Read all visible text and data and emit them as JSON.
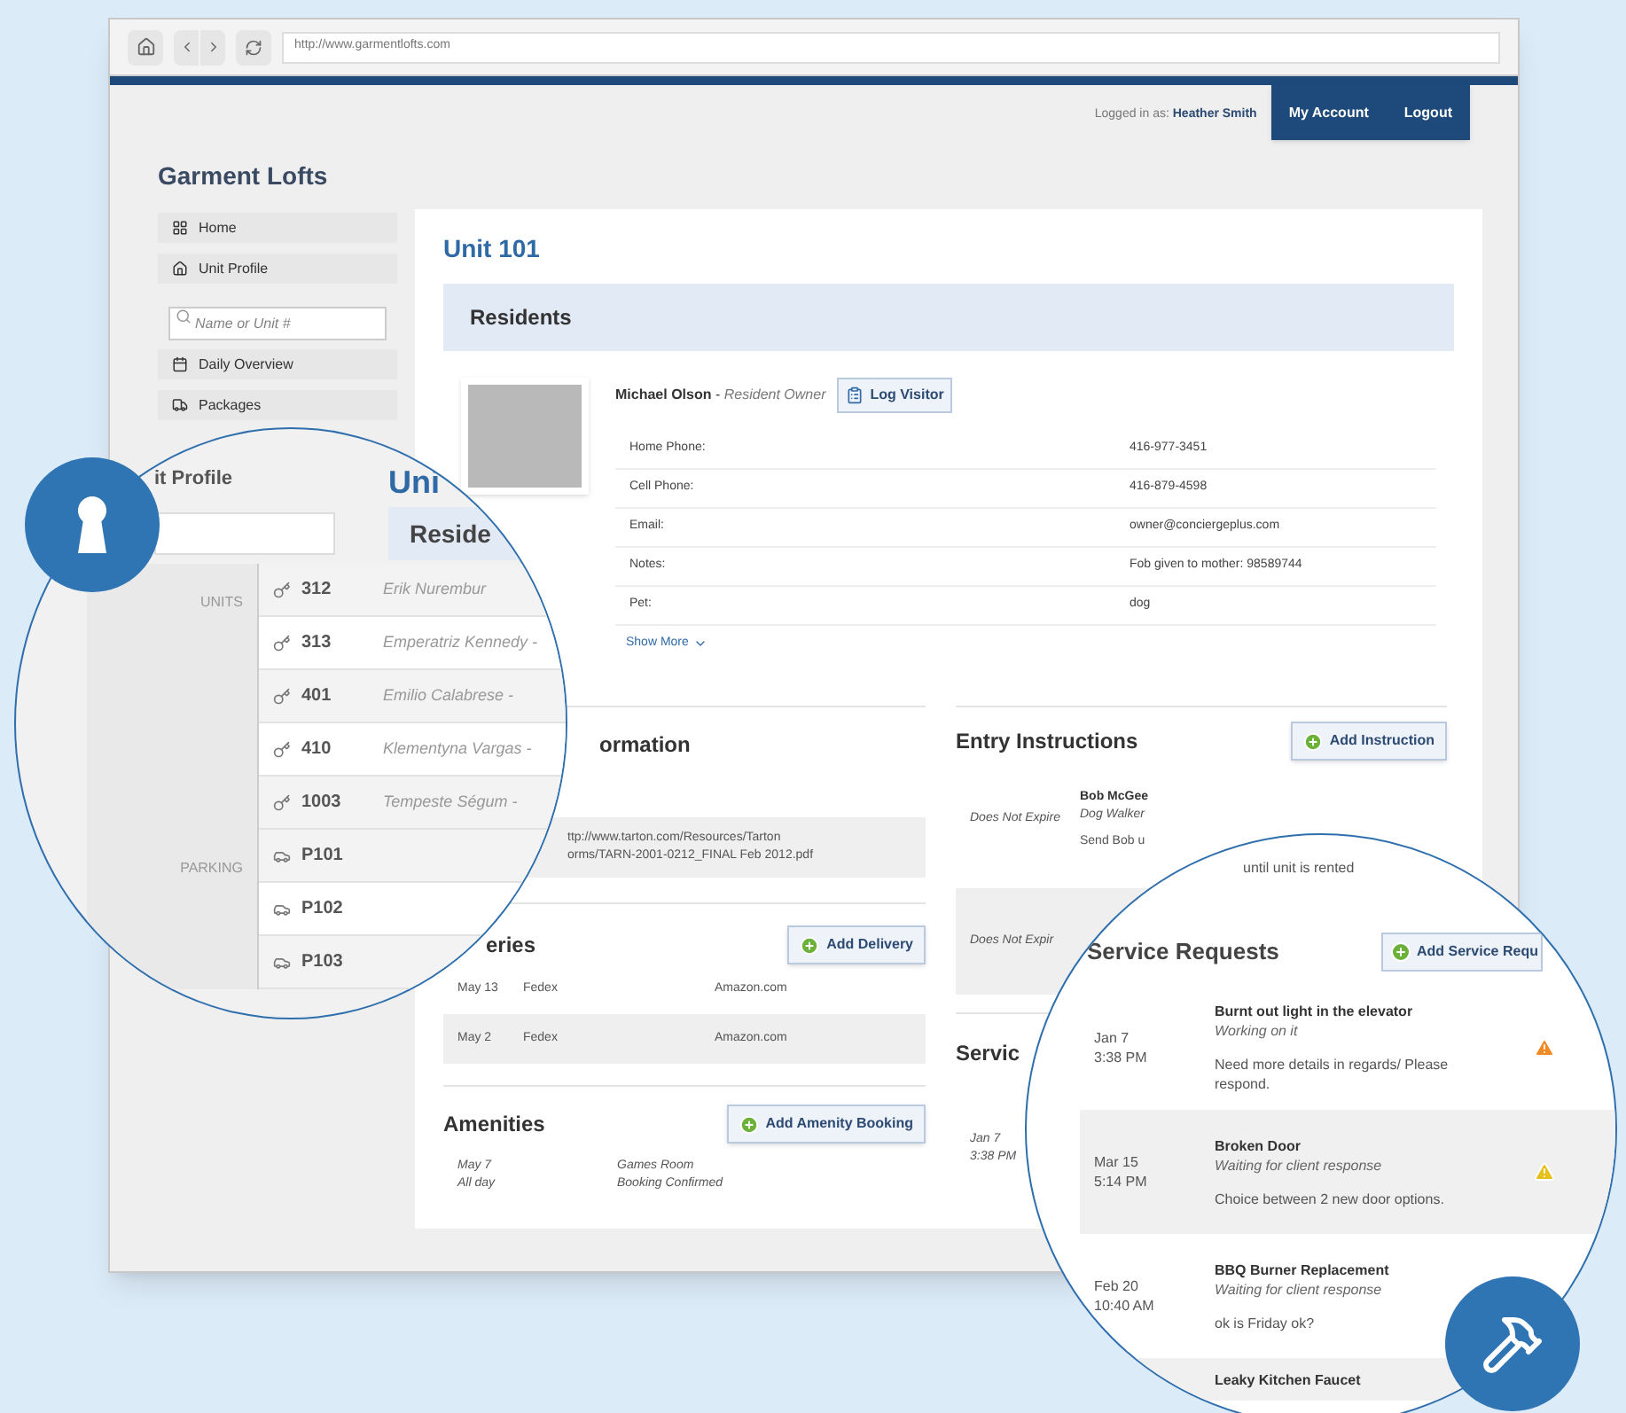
{
  "browser": {
    "url": "http://www.garmentlofts.com"
  },
  "header": {
    "logged_in_label": "Logged in as:",
    "user": "Heather Smith",
    "nav": [
      {
        "label": "My Account"
      },
      {
        "label": "Logout"
      }
    ]
  },
  "site_title": "Garment Lofts",
  "sidebar": {
    "items": [
      {
        "kind": "link",
        "label": "Home"
      },
      {
        "kind": "link",
        "label": "Unit Profile"
      },
      {
        "kind": "search",
        "placeholder": "Name or Unit #"
      },
      {
        "kind": "link",
        "label": "Daily Overview"
      },
      {
        "kind": "link",
        "label": "Packages"
      }
    ]
  },
  "unit": {
    "title": "Unit 101",
    "residents_heading": "Residents",
    "resident": {
      "name": "Michael Olson",
      "separator": "-",
      "role": "Resident Owner",
      "log_button": "Log Visitor",
      "show_more": "Show More",
      "details": [
        {
          "label": "Home Phone:",
          "value": "416-977-3451"
        },
        {
          "label": "Cell Phone:",
          "value": "416-879-4598"
        },
        {
          "label": "Email:",
          "value": "owner@conciergeplus.com"
        },
        {
          "label": "Notes:",
          "value": "Fob given to mother: 98589744"
        },
        {
          "label": "Pet:",
          "value": "dog"
        }
      ]
    }
  },
  "unit_information": {
    "heading": "ormation",
    "link_lines": [
      "ttp://www.tarton.com/Resources/Tarton",
      "orms/TARN-2001-0212_FINAL Feb 2012.pdf"
    ]
  },
  "deliveries": {
    "heading": "eries",
    "button": "Add Delivery",
    "rows": [
      {
        "date": "May 13",
        "carrier": "Fedex",
        "sender": "Amazon.com"
      },
      {
        "date": "May 2",
        "carrier": "Fedex",
        "sender": "Amazon.com"
      }
    ]
  },
  "amenities": {
    "heading": "Amenities",
    "button": "Add Amenity Booking",
    "rows": [
      {
        "date": "May 7",
        "time": "All day",
        "room": "Games Room",
        "status": "Booking Confirmed"
      }
    ]
  },
  "entry_instructions": {
    "heading": "Entry Instructions",
    "button": "Add Instruction",
    "rows": [
      {
        "expiry": "Does Not Expire",
        "name": "Bob McGee",
        "role": "Dog Walker",
        "note": "Send Bob u"
      },
      {
        "expiry": "Does Not Expir"
      }
    ]
  },
  "service_preview": {
    "heading": "Servic",
    "rows": [
      {
        "date": "Jan 7",
        "time": "3:38 PM"
      }
    ]
  },
  "units_magnifier": {
    "panel_title": "it Profile",
    "unit_heading": "Uni",
    "residents_heading": "Reside",
    "groups": [
      {
        "label": "UNITS",
        "rows": [
          {
            "kind": "unit",
            "number": "312",
            "resident": "Erik Nurembur"
          },
          {
            "kind": "unit",
            "number": "313",
            "resident": "Emperatriz Kennedy -"
          },
          {
            "kind": "unit",
            "number": "401",
            "resident": "Emilio Calabrese -"
          },
          {
            "kind": "unit",
            "number": "410",
            "resident": "Klementyna Vargas -"
          },
          {
            "kind": "unit",
            "number": "1003",
            "resident": "Tempeste Ségum -"
          }
        ]
      },
      {
        "label": "PARKING",
        "rows": [
          {
            "kind": "parking",
            "number": "P101"
          },
          {
            "kind": "parking",
            "number": "P102"
          },
          {
            "kind": "parking",
            "number": "P103"
          }
        ]
      }
    ]
  },
  "service_magnifier": {
    "note_fragment": "until unit is rented",
    "heading": "Service Requests",
    "button": "Add Service Requ",
    "requests": [
      {
        "date": "Jan 7",
        "time": "3:38 PM",
        "title": "Burnt out light in the elevator",
        "status": "Working on it",
        "note": "Need more details in regards/ Please respond.",
        "color": "#f08a24"
      },
      {
        "date": "Mar 15",
        "time": "5:14 PM",
        "title": "Broken Door",
        "status": "Waiting for client response",
        "note": "Choice between 2 new door options.",
        "color": "#e6c01c"
      },
      {
        "date": "Feb 20",
        "time": "10:40 AM",
        "title": "BBQ Burner Replacement",
        "status": "Waiting for client response",
        "note": "ok is Friday ok?"
      },
      {
        "title": "Leaky Kitchen Faucet"
      }
    ]
  }
}
